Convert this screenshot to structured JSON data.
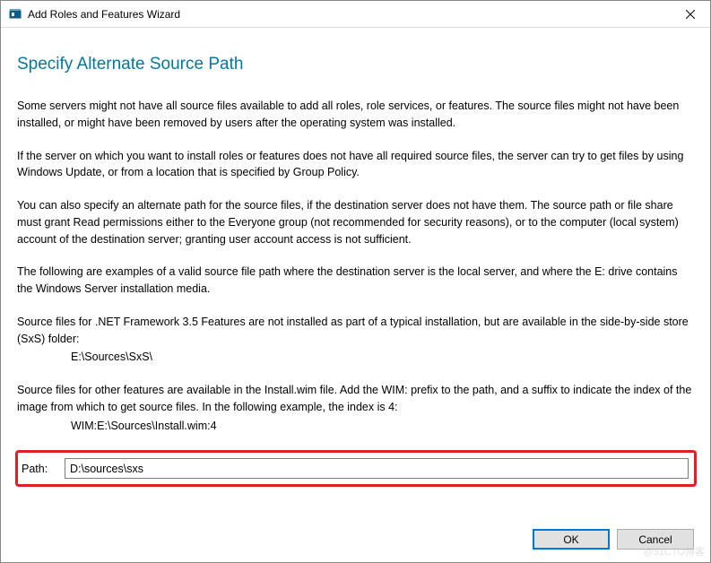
{
  "window": {
    "title": "Add Roles and Features Wizard"
  },
  "heading": "Specify Alternate Source Path",
  "paragraphs": {
    "p1": "Some servers might not have all source files available to add all roles, role services, or features. The source files might not have been installed, or might have been removed by users after the operating system was installed.",
    "p2": "If the server on which you want to install roles or features does not have all required source files, the server can try to get files by using Windows Update, or from a location that is specified by Group Policy.",
    "p3": "You can also specify an alternate path for the source files, if the destination server does not have them. The source path or file share must grant Read permissions either to the Everyone group (not recommended for security reasons), or to the computer (local system) account of the destination server; granting user account access is not sufficient.",
    "p4": "The following are examples of a valid source file path where the destination server is the local server, and where the E: drive contains the Windows Server installation media.",
    "p5": "Source files for .NET Framework 3.5 Features are not installed as part of a typical installation, but are available in the side-by-side store (SxS) folder:",
    "example1": "E:\\Sources\\SxS\\",
    "p6": "Source files for other features are available in the Install.wim file. Add the WIM: prefix to the path, and a suffix to indicate the index of the image from which to get source files. In the following example, the index is 4:",
    "example2": "WIM:E:\\Sources\\Install.wim:4"
  },
  "form": {
    "path_label": "Path:",
    "path_value": "D:\\sources\\sxs"
  },
  "buttons": {
    "ok": "OK",
    "cancel": "Cancel"
  },
  "watermark": "@51CTO博客"
}
